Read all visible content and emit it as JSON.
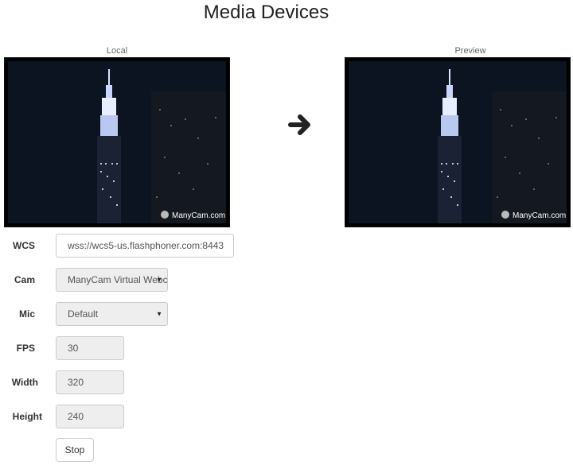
{
  "title": "Media Devices",
  "videos": {
    "local_label": "Local",
    "preview_label": "Preview",
    "watermark": "ManyCam.com"
  },
  "form": {
    "wcs": {
      "label": "WCS",
      "value": "wss://wcs5-us.flashphoner.com:8443"
    },
    "cam": {
      "label": "Cam",
      "value": "ManyCam Virtual Webcam"
    },
    "mic": {
      "label": "Mic",
      "value": "Default"
    },
    "fps": {
      "label": "FPS",
      "value": "30"
    },
    "width": {
      "label": "Width",
      "value": "320"
    },
    "height": {
      "label": "Height",
      "value": "240"
    }
  },
  "buttons": {
    "stop": "Stop"
  },
  "icons": {
    "arrow": "arrow-right-icon",
    "caret": "chevron-down-icon",
    "watermark_logo": "manycam-logo-icon"
  }
}
